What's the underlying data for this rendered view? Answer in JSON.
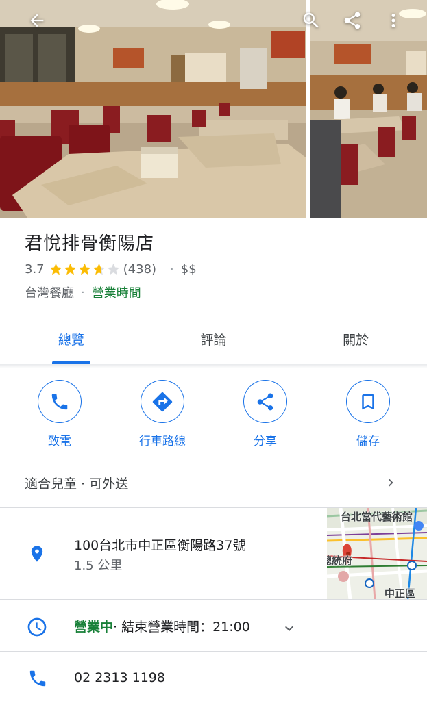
{
  "header": {
    "back_icon": "arrow-left-icon",
    "search_icon": "search-icon",
    "share_icon": "share-icon",
    "more_icon": "more-vert-icon"
  },
  "place": {
    "name": "君悅排骨衡陽店",
    "rating": "3.7",
    "rating_value": 3.7,
    "review_count": "(438)",
    "price_level": "$$",
    "category": "台灣餐廳",
    "hours_link": "營業時間",
    "separator": "·"
  },
  "tabs": [
    {
      "label": "總覽",
      "active": true
    },
    {
      "label": "評論",
      "active": false
    },
    {
      "label": "關於",
      "active": false
    }
  ],
  "actions": [
    {
      "label": "致電",
      "icon": "phone-icon"
    },
    {
      "label": "行車路線",
      "icon": "directions-icon"
    },
    {
      "label": "分享",
      "icon": "share-icon"
    },
    {
      "label": "儲存",
      "icon": "bookmark-icon"
    }
  ],
  "attributes": {
    "text": "適合兒童 · 可外送"
  },
  "address": {
    "line": "100台北市中正區衡陽路37號",
    "distance": "1.5 公里",
    "map_labels": [
      "台北當代藝術館",
      "總統府",
      "中正區"
    ]
  },
  "hours": {
    "status": "營業中",
    "detail": " · 結束營業時間：21:00"
  },
  "phone": {
    "number": "02 2313 1198"
  },
  "colors": {
    "accent": "#1a73e8",
    "open_green": "#188038",
    "star": "#fbbc04",
    "divider": "#dadce0"
  }
}
